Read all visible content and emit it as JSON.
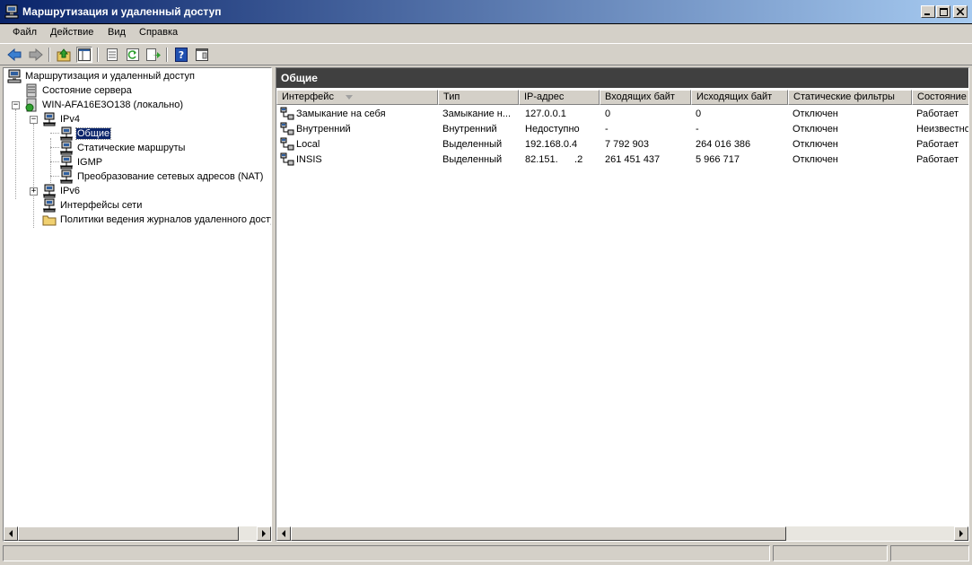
{
  "window": {
    "title": "Маршрутизация и удаленный доступ",
    "icon": "network-computer-icon",
    "controls": [
      "minimize-icon",
      "maximize-icon",
      "close-icon"
    ]
  },
  "menu": [
    {
      "label": "Файл"
    },
    {
      "label": "Действие"
    },
    {
      "label": "Вид"
    },
    {
      "label": "Справка"
    }
  ],
  "toolbar": {
    "buttons": [
      "back-arrow-icon",
      "forward-arrow-icon",
      "up-folder-icon",
      "show-hide-tree-icon",
      "properties-icon",
      "refresh-icon",
      "export-list-icon",
      "help-icon",
      "console-icon"
    ]
  },
  "tree": {
    "items": [
      {
        "label": "Маршрутизация и удаленный доступ",
        "icon": "network-computer-icon"
      },
      {
        "label": "Состояние сервера",
        "icon": "server-icon"
      },
      {
        "label": "WIN-AFA16E3O138 (локально)",
        "icon": "server-status-icon",
        "expander": "−"
      },
      {
        "label": "IPv4",
        "icon": "network-node-icon",
        "expander": "−"
      },
      {
        "label": "Общие",
        "icon": "network-node-icon",
        "selected": true
      },
      {
        "label": "Статические маршруты",
        "icon": "network-node-icon"
      },
      {
        "label": "IGMP",
        "icon": "network-node-icon"
      },
      {
        "label": "Преобразование сетевых адресов (NAT)",
        "icon": "network-node-icon"
      },
      {
        "label": "IPv6",
        "icon": "network-node-icon",
        "expander": "+"
      },
      {
        "label": "Интерфейсы сети",
        "icon": "network-node-icon"
      },
      {
        "label": "Политики ведения журналов удаленного доступа",
        "icon": "folder-icon"
      }
    ]
  },
  "details": {
    "header_title": "Общие",
    "columns": [
      "Интерфейс",
      "Тип",
      "IP-адрес",
      "Входящих байт",
      "Исходящих байт",
      "Статические фильтры",
      "Состояние"
    ],
    "rows": [
      [
        "Замыкание на себя",
        "Замыкание н...",
        "127.0.0.1",
        "0",
        "0",
        "Отключен",
        "Работает"
      ],
      [
        "Внутренний",
        "Внутренний",
        "Недоступно",
        "-",
        "-",
        "Отключен",
        "Неизвестно"
      ],
      [
        "Local",
        "Выделенный",
        "192.168.0.4",
        "7 792 903",
        "264 016 386",
        "Отключен",
        "Работает"
      ],
      [
        "INSIS",
        "Выделенный",
        "82.151.      .2",
        "261 451 437",
        "5 966 717",
        "Отключен",
        "Работает"
      ]
    ]
  },
  "colors": {
    "title_gradient_start": "#0a246a",
    "title_gradient_end": "#a6caf0",
    "selection": "#0a246a",
    "details_header": "#404040",
    "face": "#d4d0c8"
  }
}
